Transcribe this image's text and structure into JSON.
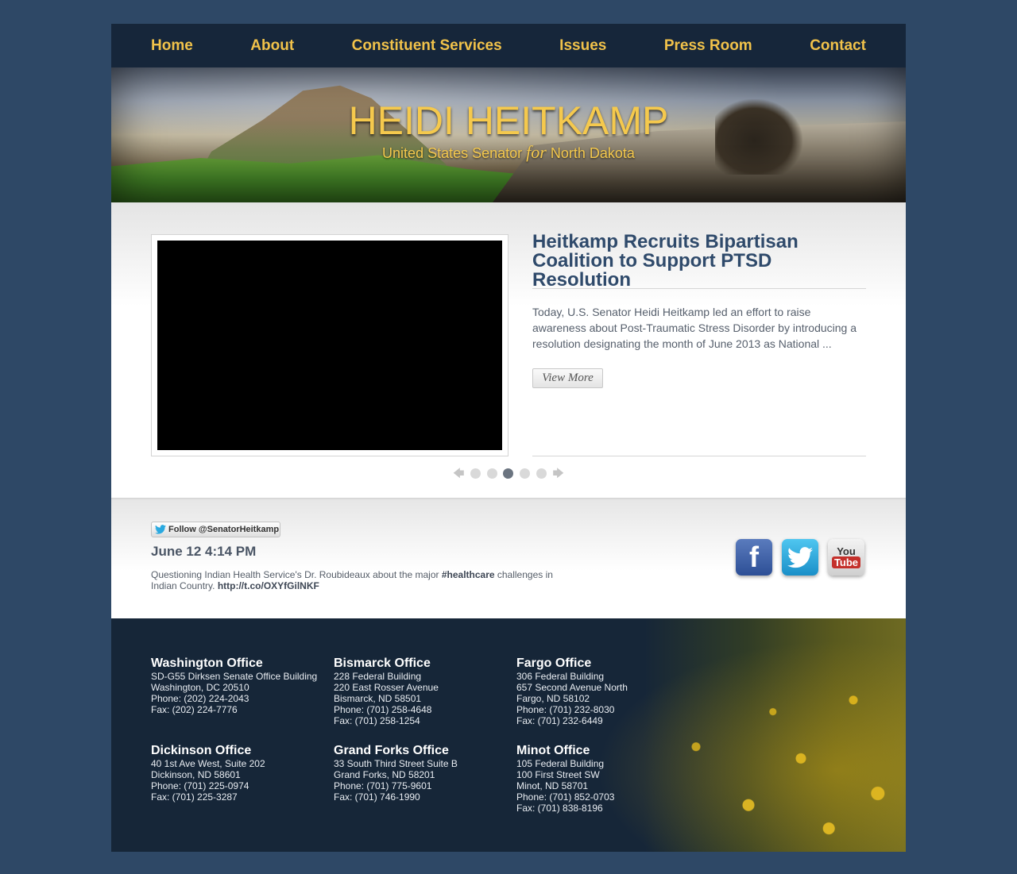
{
  "nav": {
    "items": [
      {
        "label": "Home"
      },
      {
        "label": "About"
      },
      {
        "label": "Constituent Services"
      },
      {
        "label": "Issues"
      },
      {
        "label": "Press Room"
      },
      {
        "label": "Contact"
      }
    ],
    "color": "#f1c24a"
  },
  "banner": {
    "title": "HEIDI HEITKAMP",
    "subtitle_pre": "United States Senator",
    "subtitle_for": "for",
    "subtitle_post": "North Dakota"
  },
  "feature": {
    "title": "Heitkamp Recruits Bipartisan Coalition to Support PTSD Resolution",
    "text": "Today, U.S. Senator Heidi Heitkamp led an effort to raise awareness about Post-Traumatic Stress Disorder by introducing a resolution designating the month of June 2013 as National ...",
    "view_more": "View More",
    "pager": {
      "prev": "🡄",
      "next": "🡆",
      "active_index": 3,
      "count": 5
    }
  },
  "tweet": {
    "follow_label": "Follow @SenatorHeitkamp",
    "time": "June 12 4:14 PM",
    "text_1": "Questioning Indian Health Service's Dr. Roubideaux about the major ",
    "hashtag": "#healthcare",
    "text_2": " challenges in Indian Country. ",
    "link": "http://t.co/OXYfGilNKF"
  },
  "social": {
    "facebook": "f",
    "youtube_you": "You",
    "youtube_tube": "Tube"
  },
  "offices": [
    {
      "name": "Washington Office",
      "lines": [
        "SD-G55 Dirksen Senate Office Building",
        "Washington, DC 20510",
        "Phone: (202) 224-2043",
        "Fax: (202) 224-7776"
      ]
    },
    {
      "name": "Bismarck Office",
      "lines": [
        "228 Federal Building",
        "220 East Rosser Avenue",
        "Bismarck, ND 58501",
        "Phone: (701) 258-4648",
        "Fax: (701) 258-1254"
      ]
    },
    {
      "name": "Fargo Office",
      "lines": [
        "306 Federal Building",
        "657 Second Avenue North",
        "Fargo, ND 58102",
        "Phone: (701) 232-8030",
        "Fax: (701) 232-6449"
      ]
    },
    {
      "name": "Dickinson Office",
      "lines": [
        "40 1st Ave West, Suite 202",
        "Dickinson, ND 58601",
        "Phone: (701) 225-0974",
        "Fax: (701) 225-3287"
      ]
    },
    {
      "name": "Grand Forks Office",
      "lines": [
        "33 South Third Street Suite B",
        "Grand Forks, ND 58201",
        "Phone: (701) 775-9601",
        "Fax: (701) 746-1990"
      ]
    },
    {
      "name": "Minot Office",
      "lines": [
        "105 Federal Building",
        "100 First Street SW",
        "Minot, ND 58701",
        "Phone: (701) 852-0703",
        "Fax: (701) 838-8196"
      ]
    }
  ]
}
